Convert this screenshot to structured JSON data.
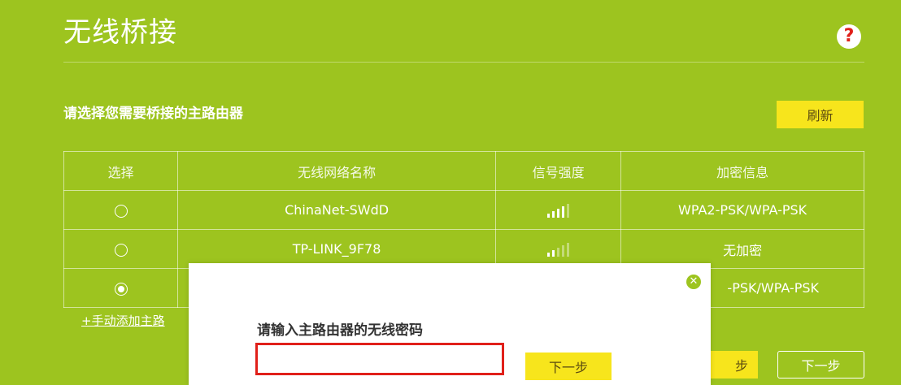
{
  "header": {
    "title": "无线桥接",
    "help_label": "?"
  },
  "instruction": "请选择您需要桥接的主路由器",
  "refresh_label": "刷新",
  "table": {
    "headers": [
      "选择",
      "无线网络名称",
      "信号强度",
      "加密信息"
    ],
    "rows": [
      {
        "ssid": "ChinaNet-SWdD",
        "security": "WPA2-PSK/WPA-PSK",
        "signal_bars": 4,
        "selected": false
      },
      {
        "ssid": "TP-LINK_9F78",
        "security": "无加密",
        "signal_bars": 2,
        "selected": false
      },
      {
        "ssid": "",
        "security": "-PSK/WPA-PSK",
        "signal_bars": 0,
        "selected": true
      }
    ]
  },
  "manual_add_label": "+手动添加主路",
  "bottom_buttons": {
    "next_yellow_label": "步",
    "next_outline_label": "下一步"
  },
  "modal": {
    "label": "请输入主路由器的无线密码",
    "password_value": "",
    "next_label": "下一步"
  },
  "colors": {
    "background": "#9dc41f",
    "accent_yellow": "#f7e51c",
    "input_border": "#e0201a"
  }
}
